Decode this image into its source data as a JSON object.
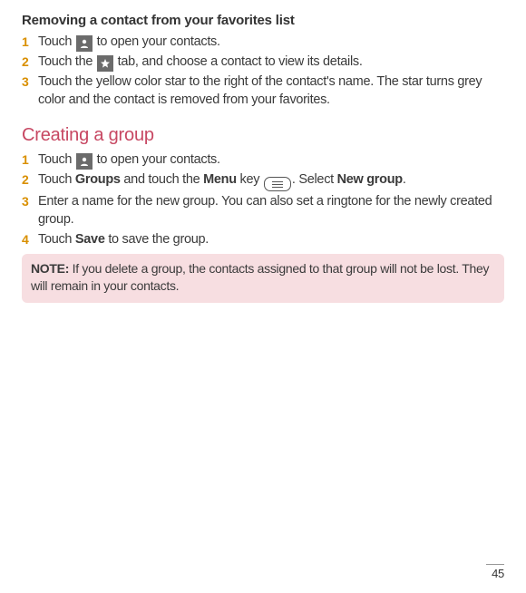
{
  "section1": {
    "heading": "Removing a contact from your favorites list",
    "steps": [
      {
        "num": "1",
        "pre": "Touch ",
        "icon": "contacts",
        "post": " to open your contacts."
      },
      {
        "num": "2",
        "pre": "Touch the ",
        "icon": "star",
        "post": " tab, and choose a contact to view its details."
      },
      {
        "num": "3",
        "text": "Touch the yellow color star to the right of the contact's name. The star turns grey color and the contact is removed from your favorites."
      }
    ]
  },
  "section2": {
    "heading": "Creating a group",
    "steps": [
      {
        "num": "1",
        "pre": "Touch ",
        "icon": "contacts",
        "post": " to open your contacts."
      },
      {
        "num": "2",
        "part1": "Touch ",
        "bold1": "Groups",
        "part2": " and touch the ",
        "bold2": "Menu",
        "part3": " key ",
        "part4": ". Select ",
        "bold3": "New group",
        "part5": "."
      },
      {
        "num": "3",
        "text": "Enter a name for the new group. You can also set a ringtone for the newly created group."
      },
      {
        "num": "4",
        "part1": "Touch ",
        "bold1": "Save",
        "part2": " to save the group."
      }
    ]
  },
  "note": {
    "label": "NOTE:",
    "text": " If you delete a group, the contacts assigned to that group will not be lost. They will remain in your contacts."
  },
  "page_number": "45"
}
